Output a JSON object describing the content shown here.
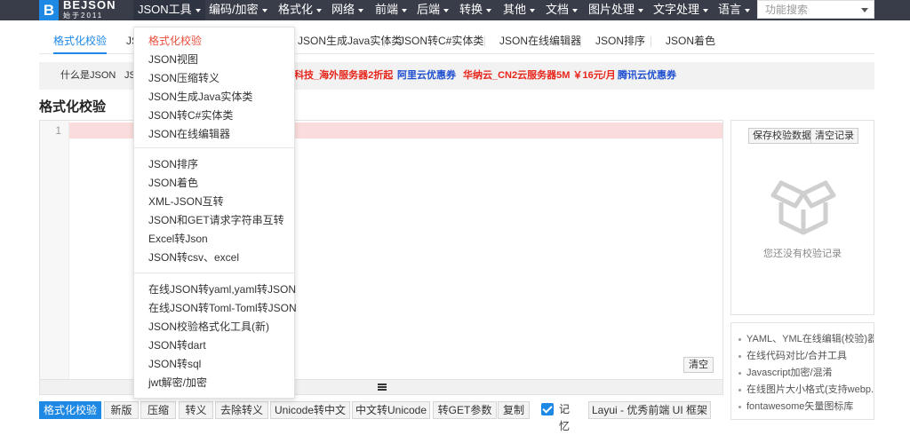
{
  "nav": {
    "logo_mark": "B",
    "logo_name": "BEJSON",
    "logo_sub": "始于2011",
    "items": [
      {
        "label": "JSON工具",
        "active": true
      },
      {
        "label": "编码/加密"
      },
      {
        "label": "格式化"
      },
      {
        "label": "网络"
      },
      {
        "label": "前端"
      },
      {
        "label": "后端"
      },
      {
        "label": "转换"
      },
      {
        "label": "其他"
      },
      {
        "label": "文档"
      },
      {
        "label": "图片处理"
      },
      {
        "label": "文字处理"
      },
      {
        "label": "语言"
      }
    ],
    "search_placeholder": "功能搜索"
  },
  "tabs": [
    {
      "label": "格式化校验",
      "active": true
    },
    {
      "label": "JS"
    },
    {
      "label": "JSON生成Java实体类"
    },
    {
      "label": "JSON转C#实体类"
    },
    {
      "label": "JSON在线编辑器"
    },
    {
      "label": "JSON排序"
    },
    {
      "label": "JSON着色"
    }
  ],
  "ads": [
    {
      "label": "什么是JSON",
      "color": "#333333"
    },
    {
      "label": "JS",
      "color": "#333333"
    },
    {
      "label": "科技_海外服务器2折起",
      "color": "#e8251b"
    },
    {
      "label": "阿里云优惠券",
      "color": "#1f4fd1"
    },
    {
      "label": "华纳云_CN2云服务器5M ￥16元/月",
      "color": "#e8251b"
    },
    {
      "label": "腾讯云优惠券",
      "color": "#1f4fd1"
    }
  ],
  "page_title": "格式化校验",
  "editor": {
    "line_number": "1",
    "clear_label": "清空"
  },
  "toolbar": {
    "buttons": [
      "格式化校验",
      "新版",
      "压缩",
      "转义",
      "去除转义",
      "Unicode转中文",
      "中文转Unicode",
      "转GET参数",
      "复制"
    ],
    "memory_label": "记忆",
    "layui_label": "Layui - 优秀前端 UI 框架"
  },
  "right_panel": {
    "save_label": "保存校验数据",
    "clear_label": "清空记录",
    "empty_text": "您还没有校验记录",
    "icon": "empty-box-icon"
  },
  "links": [
    "YAML、YML在线编辑(校验)器",
    "在线代码对比/合并工具",
    "Javascript加密/混淆",
    "在线图片大小格式(支持webp...",
    "fontawesome矢量图标库"
  ],
  "dropdown": {
    "groups": [
      [
        "格式化校验",
        "JSON视图",
        "JSON压缩转义",
        "JSON生成Java实体类",
        "JSON转C#实体类",
        "JSON在线编辑器"
      ],
      [
        "JSON排序",
        "JSON着色",
        "XML-JSON互转",
        "JSON和GET请求字符串互转",
        "Excel转Json",
        "JSON转csv、excel"
      ],
      [
        "在线JSON转yaml,yaml转JSON",
        "在线JSON转Toml-Toml转JSON",
        "JSON校验格式化工具(新)",
        "JSON转dart",
        "JSON转sql",
        "jwt解密/加密"
      ]
    ],
    "selected": "格式化校验"
  },
  "colors": {
    "nav_bg": "#393d49",
    "accent": "#1e88e5",
    "selected": "#e94e3c",
    "error_line": "#fadcdc"
  }
}
